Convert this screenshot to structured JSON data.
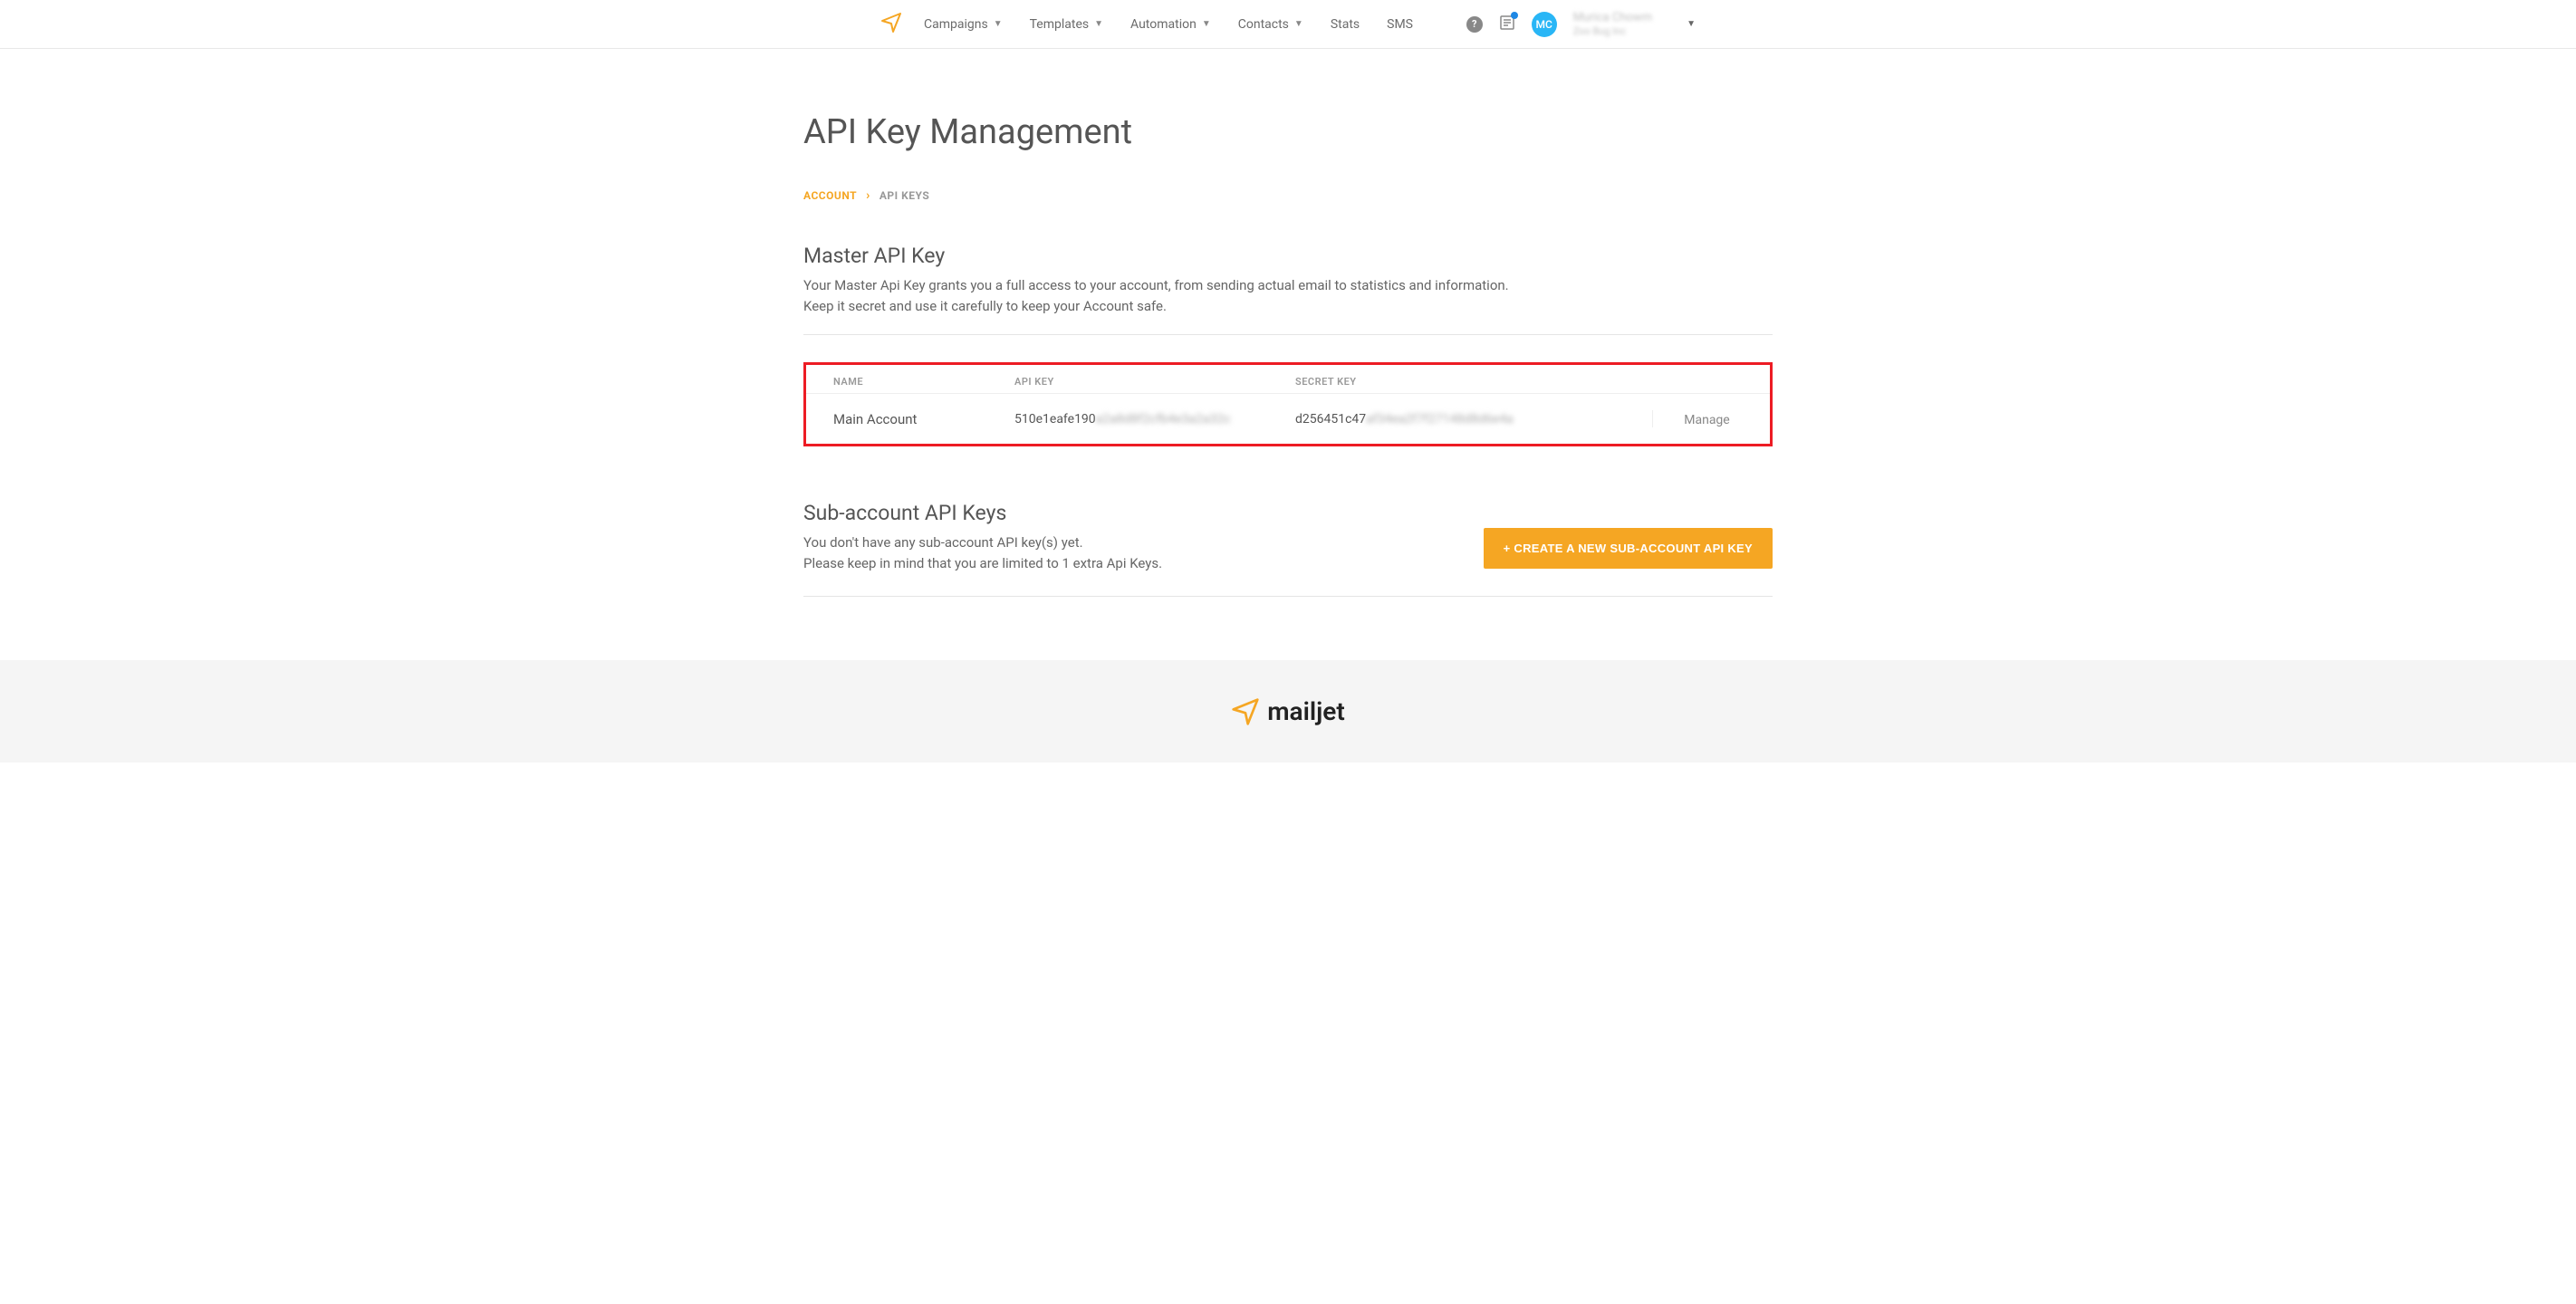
{
  "nav": {
    "items": [
      "Campaigns",
      "Templates",
      "Automation",
      "Contacts",
      "Stats",
      "SMS"
    ]
  },
  "user": {
    "initials": "MC",
    "name": "Murica Chowm",
    "company": "Zoo Bug Inc"
  },
  "page": {
    "title": "API Key Management"
  },
  "breadcrumb": {
    "root": "ACCOUNT",
    "current": "API KEYS"
  },
  "master": {
    "title": "Master API Key",
    "desc1": "Your Master Api Key grants you a full access to your account, from sending actual email to statistics and information.",
    "desc2": "Keep it secret and use it carefully to keep your Account safe.",
    "columns": {
      "name": "NAME",
      "api": "API KEY",
      "secret": "SECRET KEY"
    },
    "row": {
      "name": "Main Account",
      "api_prefix": "510e1eafe190",
      "api_suffix": "a2a8d8f2cfb4e3a2a32c",
      "secret_prefix": "d256451c47",
      "secret_suffix": "af34ea2f7f27148d8d6e4a",
      "manage": "Manage"
    }
  },
  "subaccount": {
    "title": "Sub-account API Keys",
    "desc1": "You don't have any sub-account API key(s) yet.",
    "desc2": "Please keep in mind that you are limited to 1 extra Api Keys.",
    "button": "+  CREATE A NEW SUB-ACCOUNT API KEY"
  },
  "footer": {
    "brand": "mailjet"
  }
}
